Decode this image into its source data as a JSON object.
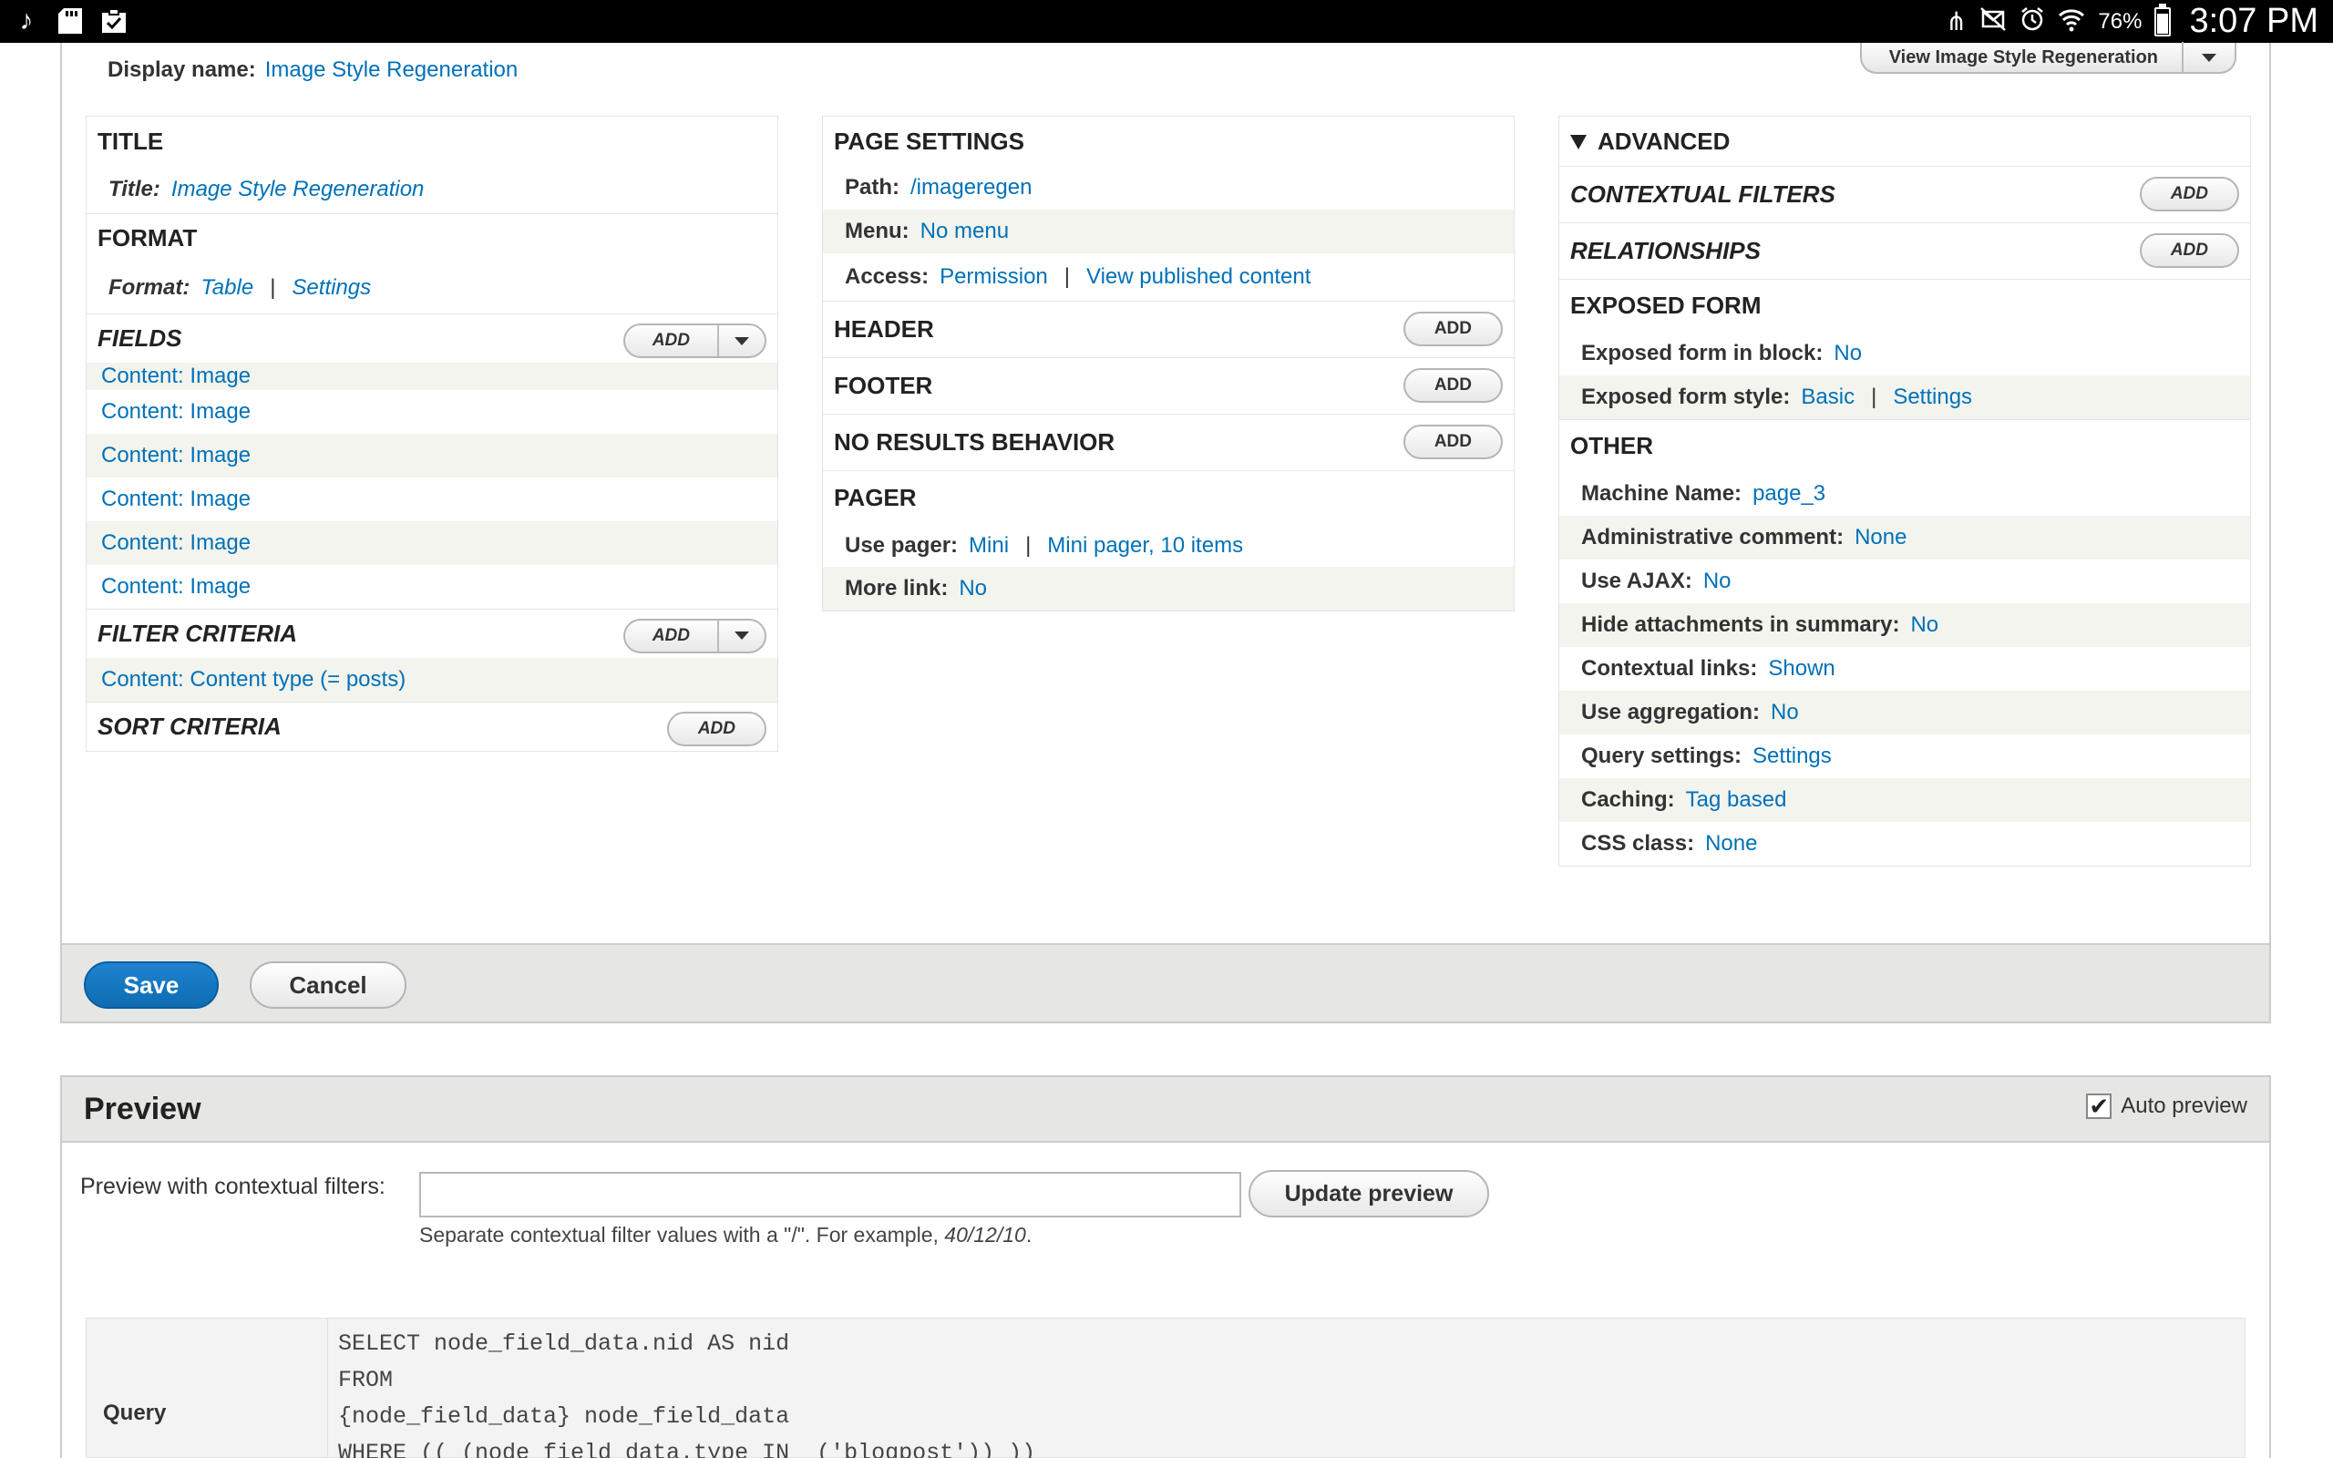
{
  "statusbar": {
    "battery": "76%",
    "time": "3:07 PM"
  },
  "display": {
    "label": "Display name:",
    "value": "Image Style Regeneration",
    "view_button": "View Image Style Regeneration"
  },
  "col1": {
    "title": {
      "heading": "TITLE",
      "label": "Title:",
      "value": "Image Style Regeneration"
    },
    "format": {
      "heading": "FORMAT",
      "label": "Format:",
      "value": "Table",
      "settings": "Settings"
    },
    "fields": {
      "heading": "FIELDS",
      "add": "Add",
      "items": [
        "Content: Image",
        "Content: Image",
        "Content: Image",
        "Content: Image",
        "Content: Image",
        "Content: Image"
      ]
    },
    "filter": {
      "heading": "FILTER CRITERIA",
      "add": "Add",
      "items": [
        "Content: Content type (= posts)"
      ]
    },
    "sort": {
      "heading": "SORT CRITERIA",
      "add": "Add"
    }
  },
  "col2": {
    "page_settings": {
      "heading": "PAGE SETTINGS",
      "path_label": "Path:",
      "path_value": "/imageregen",
      "menu_label": "Menu:",
      "menu_value": "No menu",
      "access_label": "Access:",
      "access_value": "Permission",
      "access_extra": "View published content"
    },
    "header": {
      "heading": "HEADER",
      "add": "Add"
    },
    "footer": {
      "heading": "FOOTER",
      "add": "Add"
    },
    "no_results": {
      "heading": "NO RESULTS BEHAVIOR",
      "add": "Add"
    },
    "pager": {
      "heading": "PAGER",
      "use_label": "Use pager:",
      "use_value": "Mini",
      "use_extra": "Mini pager, 10 items",
      "more_label": "More link:",
      "more_value": "No"
    }
  },
  "col3": {
    "advanced": {
      "heading": "ADVANCED"
    },
    "contextual": {
      "heading": "CONTEXTUAL FILTERS",
      "add": "Add"
    },
    "relationships": {
      "heading": "RELATIONSHIPS",
      "add": "Add"
    },
    "exposed": {
      "heading": "EXPOSED FORM",
      "block_label": "Exposed form in block:",
      "block_value": "No",
      "style_label": "Exposed form style:",
      "style_value": "Basic",
      "style_settings": "Settings"
    },
    "other": {
      "heading": "OTHER",
      "rows": [
        {
          "label": "Machine Name:",
          "value": "page_3"
        },
        {
          "label": "Administrative comment:",
          "value": "None"
        },
        {
          "label": "Use AJAX:",
          "value": "No"
        },
        {
          "label": "Hide attachments in summary:",
          "value": "No"
        },
        {
          "label": "Contextual links:",
          "value": "Shown"
        },
        {
          "label": "Use aggregation:",
          "value": "No"
        },
        {
          "label": "Query settings:",
          "value": "Settings"
        },
        {
          "label": "Caching:",
          "value": "Tag based"
        },
        {
          "label": "CSS class:",
          "value": "None"
        }
      ]
    }
  },
  "actions": {
    "save": "Save",
    "cancel": "Cancel"
  },
  "preview": {
    "title": "Preview",
    "auto_preview": "Auto preview",
    "ctx_label": "Preview with contextual filters:",
    "ctx_value": "",
    "update": "Update preview",
    "desc_prefix": "Separate contextual filter values with a \"/\". For example, ",
    "desc_example": "40/12/10",
    "desc_suffix": ".",
    "query_label": "Query",
    "query_lines": [
      "SELECT node_field_data.nid AS nid",
      "FROM",
      "{node_field_data} node_field_data",
      "WHERE (( (node_field_data.type IN  ('blogpost')) ))"
    ]
  }
}
